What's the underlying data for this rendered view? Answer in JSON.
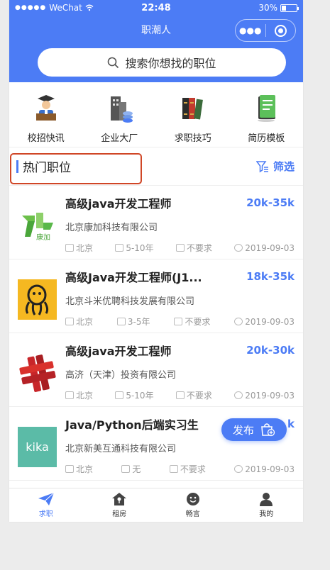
{
  "status": {
    "carrier": "WeChat",
    "time": "22:48",
    "battery": "30%"
  },
  "nav": {
    "title": "职潮人"
  },
  "search": {
    "placeholder": "搜索你想找的职位"
  },
  "categories": [
    {
      "label": "校招快讯",
      "icon": "graduation-speaker-icon"
    },
    {
      "label": "企业大厂",
      "icon": "buildings-icon"
    },
    {
      "label": "求职技巧",
      "icon": "books-icon"
    },
    {
      "label": "简历模板",
      "icon": "resume-icon"
    }
  ],
  "hot": {
    "title": "热门职位",
    "filter": "筛选"
  },
  "jobs": [
    {
      "title": "高级java开发工程师",
      "salary": "20k-35k",
      "company": "北京康加科技有限公司",
      "city": "北京",
      "experience": "5-10年",
      "education": "不要求",
      "date": "2019-09-03",
      "logo_text": "康加"
    },
    {
      "title": "高级Java开发工程师(J1...",
      "salary": "18k-35k",
      "company": "北京斗米优聘科技发展有限公司",
      "city": "北京",
      "experience": "3-5年",
      "education": "不要求",
      "date": "2019-09-03"
    },
    {
      "title": "高级java开发工程师",
      "salary": "20k-30k",
      "company": "高济（天津）投资有限公司",
      "city": "北京",
      "experience": "5-10年",
      "education": "不要求",
      "date": "2019-09-03"
    },
    {
      "title": "Java/Python后端实习生",
      "salary": "k",
      "company": "北京新美互通科技有限公司",
      "city": "北京",
      "experience": "无",
      "education": "不要求",
      "date": "2019-09-03",
      "logo_text": "kika"
    }
  ],
  "publish": {
    "label": "发布"
  },
  "tabs": [
    {
      "label": "求职",
      "icon": "paper-plane-icon"
    },
    {
      "label": "租房",
      "icon": "house-key-icon"
    },
    {
      "label": "畅言",
      "icon": "smile-icon"
    },
    {
      "label": "我的",
      "icon": "person-icon"
    }
  ],
  "colors": {
    "accent": "#4c7cf5",
    "highlight_box": "#d04626"
  }
}
